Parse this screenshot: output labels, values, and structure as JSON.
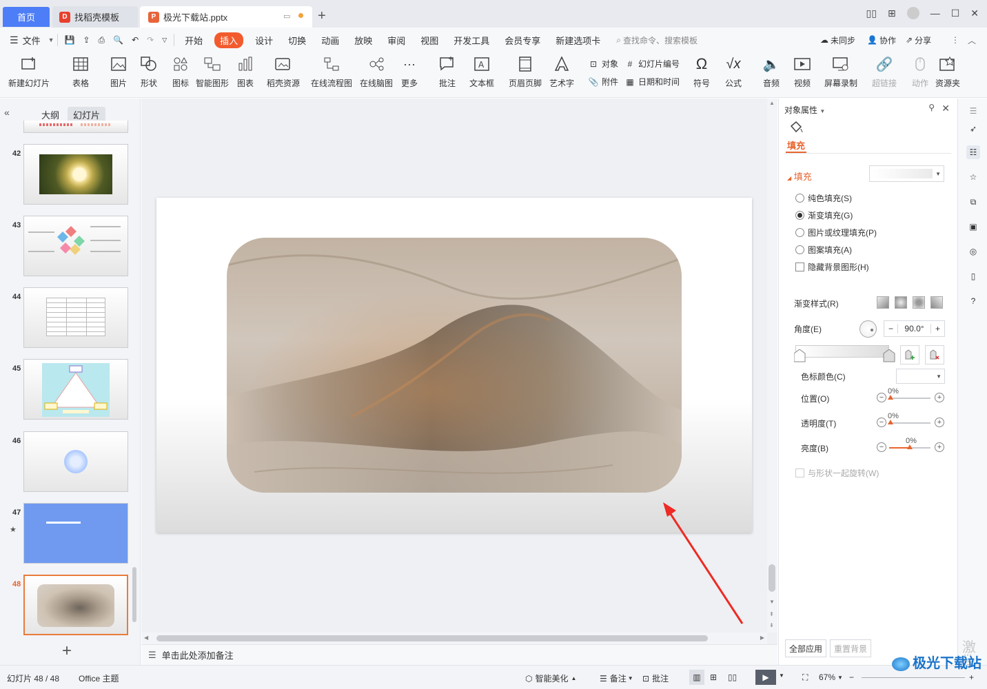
{
  "tabs": {
    "home": "首页",
    "docer": "找稻壳模板",
    "doc": "极光下载站.pptx"
  },
  "menu": [
    "文件",
    "开始",
    "插入",
    "设计",
    "切换",
    "动画",
    "放映",
    "审阅",
    "视图",
    "开发工具",
    "会员专享",
    "新建选项卡"
  ],
  "menu_active": "插入",
  "search_placeholder": "查找命令、搜索模板",
  "menu_right": {
    "sync": "未同步",
    "collab": "协作",
    "share": "分享"
  },
  "ribbon": {
    "new_slide": "新建幻灯片",
    "table": "表格",
    "picture": "图片",
    "shape": "形状",
    "icon": "图标",
    "smartart": "智能图形",
    "chart": "图表",
    "docer_res": "稻壳资源",
    "flowchart": "在线流程图",
    "mindmap": "在线脑图",
    "more": "更多",
    "comment": "批注",
    "textbox": "文本框",
    "header_footer": "页眉页脚",
    "wordart": "艺术字",
    "object": "对象",
    "attachment": "附件",
    "slide_number": "幻灯片编号",
    "date_time": "日期和时间",
    "symbol": "符号",
    "formula": "公式",
    "audio": "音频",
    "video": "视频",
    "screen_record": "屏幕录制",
    "hyperlink": "超链接",
    "action": "动作",
    "resource": "资源夹"
  },
  "left_panel": {
    "tab_outline": "大纲",
    "tab_slides": "幻灯片",
    "slides": [
      "42",
      "43",
      "44",
      "45",
      "46",
      "47",
      "48"
    ],
    "selected": "48"
  },
  "notes_placeholder": "单击此处添加备注",
  "props": {
    "title": "对象属性",
    "tab_fill": "填充",
    "section_fill": "填充",
    "solid": "纯色填充(S)",
    "gradient": "渐变填充(G)",
    "picture": "图片或纹理填充(P)",
    "pattern": "图案填充(A)",
    "hide_bg": "隐藏背景图形(H)",
    "gradient_style": "渐变样式(R)",
    "angle": "角度(E)",
    "angle_value": "90.0°",
    "stop_color": "色标颜色(C)",
    "position": "位置(O)",
    "transparency": "透明度(T)",
    "brightness": "亮度(B)",
    "position_pct": "0%",
    "transparency_pct": "0%",
    "brightness_pct": "0%",
    "rotate_with_shape": "与形状一起旋转(W)",
    "apply_all": "全部应用",
    "reset_bg": "重置背景"
  },
  "status": {
    "slide_info": "幻灯片 48 / 48",
    "theme": "Office 主题",
    "beautify": "智能美化",
    "notes": "备注",
    "comment": "批注",
    "zoom": "67%"
  },
  "watermark": "极光下载站",
  "activate": "激活"
}
